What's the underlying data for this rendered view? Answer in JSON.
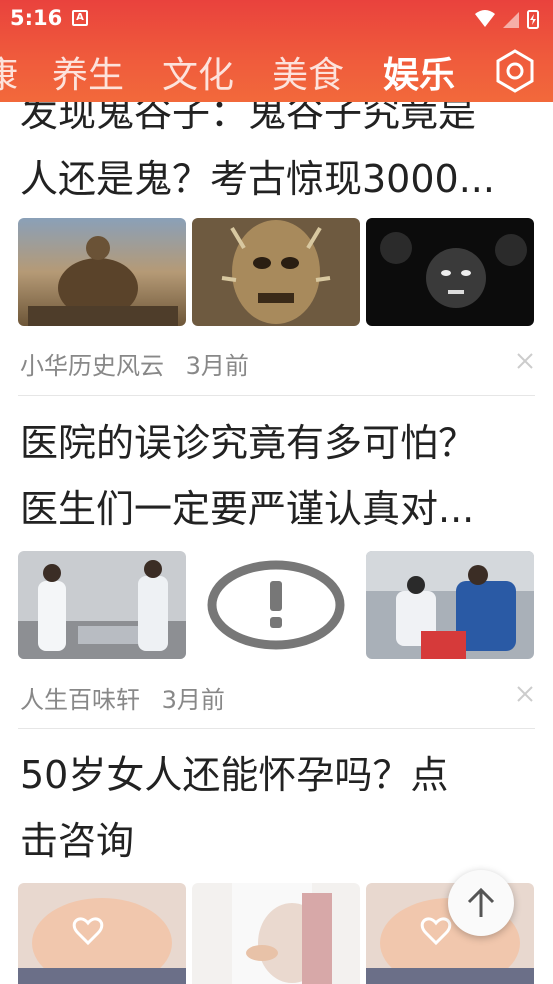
{
  "status_bar": {
    "time": "5:16",
    "notif_icon": "A"
  },
  "tabs": [
    {
      "label": "康",
      "active": false
    },
    {
      "label": "养生",
      "active": false
    },
    {
      "label": "文化",
      "active": false
    },
    {
      "label": "美食",
      "active": false
    },
    {
      "label": "娱乐",
      "active": true
    }
  ],
  "feed": [
    {
      "title_line1": "发现鬼谷子：鬼谷子究竟是",
      "title_line2": "人还是鬼？考古惊现3000...",
      "source": "小华历史风云",
      "time": "3月前"
    },
    {
      "title_line1": "医院的误诊究竟有多可怕？",
      "title_line2": "医生们一定要严谨认真对...",
      "source": "人生百味轩",
      "time": "3月前"
    },
    {
      "title_line1": "50岁女人还能怀孕吗？点",
      "title_line2": "击咨询"
    }
  ],
  "colors": {
    "header_top": "#e9423d",
    "header_bottom": "#f2693b",
    "text": "#222222",
    "meta": "#888888"
  }
}
